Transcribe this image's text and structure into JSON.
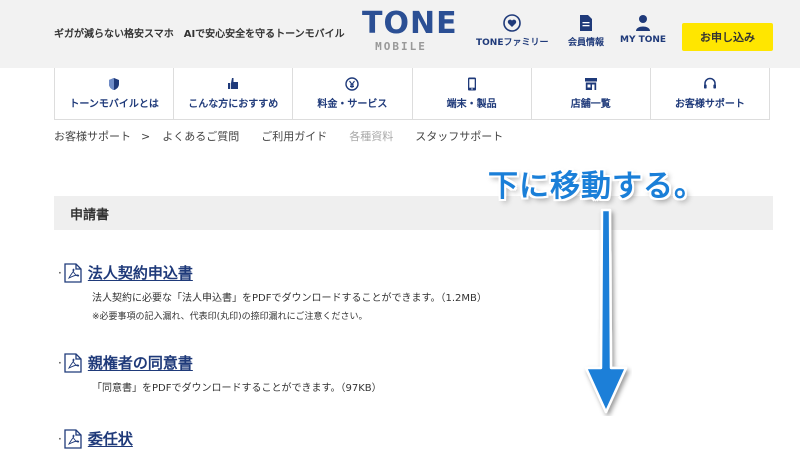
{
  "header": {
    "tagline": "ギガが減らない格安スマホ　AIで安心安全を守るトーンモバイル",
    "logo_main": "TONE",
    "logo_sub": "MOBILE",
    "nav": [
      {
        "label": "TONEファミリー",
        "icon": "heart-icon"
      },
      {
        "label": "会員情報",
        "icon": "document-icon"
      },
      {
        "label": "MY TONE",
        "icon": "person-icon"
      }
    ],
    "apply_label": "お申し込み",
    "accent_color": "#ffe600",
    "brand_color": "#2b4f94"
  },
  "global_nav": [
    {
      "label": "トーンモバイルとは",
      "icon": "shield-icon"
    },
    {
      "label": "こんな方におすすめ",
      "icon": "thumbs-up-icon"
    },
    {
      "label": "料金・サービス",
      "icon": "coin-icon"
    },
    {
      "label": "端末・製品",
      "icon": "smartphone-icon"
    },
    {
      "label": "店舗一覧",
      "icon": "store-icon"
    },
    {
      "label": "お客様サポート",
      "icon": "headset-icon"
    }
  ],
  "subnav": {
    "root": "お客様サポート",
    "separator": ">",
    "items": [
      "よくあるご質問",
      "ご利用ガイド",
      "各種資料",
      "スタッフサポート"
    ],
    "active_index": 2
  },
  "section": {
    "title": "申請書",
    "documents": [
      {
        "title": "法人契約申込書",
        "description": "法人契約に必要な「法人申込書」をPDFでダウンロードすることができます。（1.2MB）",
        "note": "※必要事項の記入漏れ、代表印(丸印)の捺印漏れにご注意ください。"
      },
      {
        "title": "親権者の同意書",
        "description": "「同意書」をPDFでダウンロードすることができます。（97KB）"
      },
      {
        "title": "委任状"
      }
    ]
  },
  "annotation": {
    "text": "下に移動する。",
    "color": "#1a7fd8"
  }
}
